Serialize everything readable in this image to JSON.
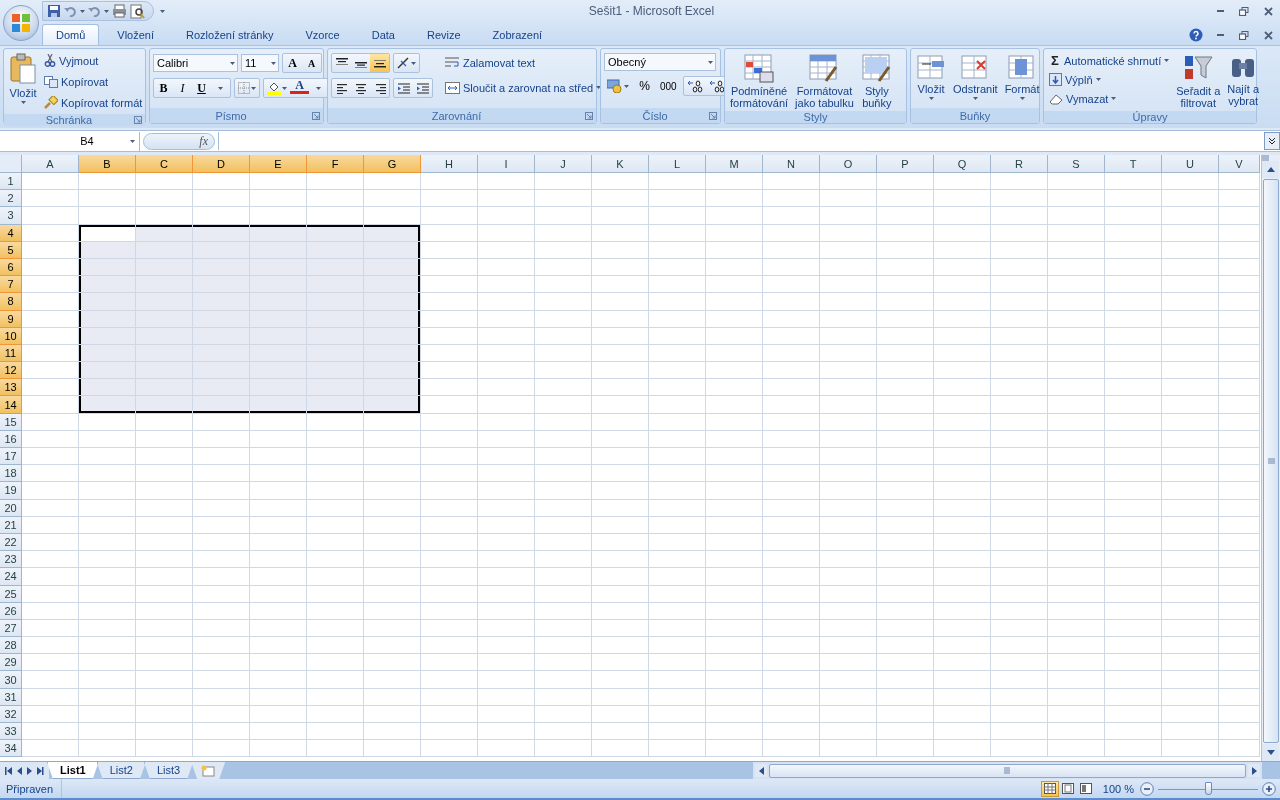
{
  "window": {
    "title": "Sešit1 - Microsoft Excel"
  },
  "tabs": [
    {
      "label": "Domů",
      "selected": true
    },
    {
      "label": "Vložení",
      "selected": false
    },
    {
      "label": "Rozložení stránky",
      "selected": false
    },
    {
      "label": "Vzorce",
      "selected": false
    },
    {
      "label": "Data",
      "selected": false
    },
    {
      "label": "Revize",
      "selected": false
    },
    {
      "label": "Zobrazení",
      "selected": false
    }
  ],
  "clipboard": {
    "title": "Schránka",
    "paste": "Vložit",
    "items": [
      "Vyjmout",
      "Kopírovat",
      "Kopírovat formát"
    ]
  },
  "font": {
    "title": "Písmo",
    "family": "Calibri",
    "size": "11",
    "grow": "A",
    "shrink": "A",
    "bold": "B",
    "italic": "I",
    "underline": "U",
    "color_letter": "A"
  },
  "alignment": {
    "title": "Zarovnání",
    "vertical": [
      {
        "selected": false
      },
      {
        "selected": false
      },
      {
        "selected": true
      }
    ],
    "wrap": "Zalamovat text",
    "merge": "Sloučit a zarovnat na střed"
  },
  "number": {
    "title": "Číslo",
    "format": "Obecný",
    "percent": "%",
    "thousands": "000"
  },
  "styles": {
    "title": "Styly",
    "buttons": [
      {
        "lines": [
          "Podmíněné",
          "formátování"
        ]
      },
      {
        "lines": [
          "Formátovat",
          "jako tabulku"
        ]
      },
      {
        "lines": [
          "Styly",
          "buňky"
        ]
      }
    ]
  },
  "cells": {
    "title": "Buňky",
    "buttons": [
      "Vložit",
      "Odstranit",
      "Formát"
    ]
  },
  "editing": {
    "title": "Úpravy",
    "sum_symbol": "Σ",
    "small": [
      "Automatické shrnutí",
      "Výplň",
      "Vymazat"
    ],
    "big": [
      {
        "lines": [
          "Seřadit a",
          "filtrovat"
        ]
      },
      {
        "lines": [
          "Najít a",
          "vybrat"
        ]
      }
    ]
  },
  "formula_bar": {
    "name_box": "B4",
    "fx": "fx"
  },
  "sheet": {
    "columns": [
      {
        "label": "A",
        "selected": false
      },
      {
        "label": "B",
        "selected": true
      },
      {
        "label": "C",
        "selected": true
      },
      {
        "label": "D",
        "selected": true
      },
      {
        "label": "E",
        "selected": true
      },
      {
        "label": "F",
        "selected": true
      },
      {
        "label": "G",
        "selected": true
      },
      {
        "label": "H",
        "selected": false
      },
      {
        "label": "I",
        "selected": false
      },
      {
        "label": "J",
        "selected": false
      },
      {
        "label": "K",
        "selected": false
      },
      {
        "label": "L",
        "selected": false
      },
      {
        "label": "M",
        "selected": false
      },
      {
        "label": "N",
        "selected": false
      },
      {
        "label": "O",
        "selected": false
      },
      {
        "label": "P",
        "selected": false
      },
      {
        "label": "Q",
        "selected": false
      },
      {
        "label": "R",
        "selected": false
      },
      {
        "label": "S",
        "selected": false
      },
      {
        "label": "T",
        "selected": false
      },
      {
        "label": "U",
        "selected": false
      },
      {
        "label": "V",
        "selected": false
      }
    ],
    "rows": [
      {
        "label": "1",
        "selected": false
      },
      {
        "label": "2",
        "selected": false
      },
      {
        "label": "3",
        "selected": false
      },
      {
        "label": "4",
        "selected": true
      },
      {
        "label": "5",
        "selected": true
      },
      {
        "label": "6",
        "selected": true
      },
      {
        "label": "7",
        "selected": true
      },
      {
        "label": "8",
        "selected": true
      },
      {
        "label": "9",
        "selected": true
      },
      {
        "label": "10",
        "selected": true
      },
      {
        "label": "11",
        "selected": true
      },
      {
        "label": "12",
        "selected": true
      },
      {
        "label": "13",
        "selected": true
      },
      {
        "label": "14",
        "selected": true
      },
      {
        "label": "15",
        "selected": false
      },
      {
        "label": "16",
        "selected": false
      },
      {
        "label": "17",
        "selected": false
      },
      {
        "label": "18",
        "selected": false
      },
      {
        "label": "19",
        "selected": false
      },
      {
        "label": "20",
        "selected": false
      },
      {
        "label": "21",
        "selected": false
      },
      {
        "label": "22",
        "selected": false
      },
      {
        "label": "23",
        "selected": false
      },
      {
        "label": "24",
        "selected": false
      },
      {
        "label": "25",
        "selected": false
      },
      {
        "label": "26",
        "selected": false
      },
      {
        "label": "27",
        "selected": false
      },
      {
        "label": "28",
        "selected": false
      },
      {
        "label": "29",
        "selected": false
      },
      {
        "label": "30",
        "selected": false
      },
      {
        "label": "31",
        "selected": false
      },
      {
        "label": "32",
        "selected": false
      },
      {
        "label": "33",
        "selected": false
      },
      {
        "label": "34",
        "selected": false
      }
    ]
  },
  "sheet_tabs": [
    {
      "label": "List1",
      "selected": true
    },
    {
      "label": "List2",
      "selected": false
    },
    {
      "label": "List3",
      "selected": false
    }
  ],
  "status_bar": {
    "text": "Připraven",
    "views": [
      {
        "selected": true
      },
      {
        "selected": false
      },
      {
        "selected": false
      }
    ],
    "zoom": "100 %",
    "zoom_slider": {
      "level": 0.5
    }
  }
}
